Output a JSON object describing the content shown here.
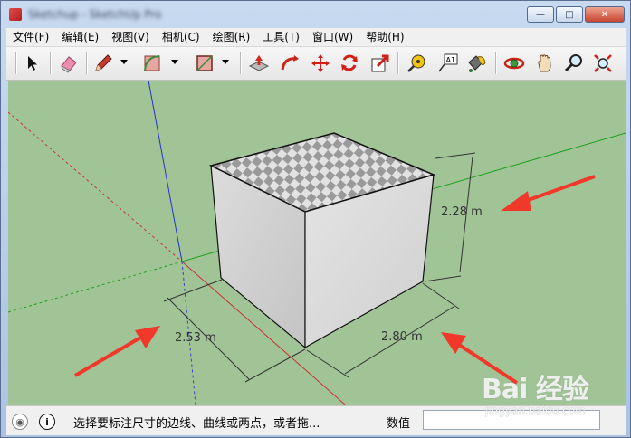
{
  "window": {
    "title": "Sketchup - SketchUp Pro",
    "btn_minimize": "—",
    "btn_maximize": "□",
    "btn_close": "✕"
  },
  "menu": {
    "items": [
      {
        "label": "文件(F)"
      },
      {
        "label": "编辑(E)"
      },
      {
        "label": "视图(V)"
      },
      {
        "label": "相机(C)"
      },
      {
        "label": "绘图(R)"
      },
      {
        "label": "工具(T)"
      },
      {
        "label": "窗口(W)"
      },
      {
        "label": "帮助(H)"
      }
    ]
  },
  "toolbar": {
    "icons": [
      "select-arrow-icon",
      "eraser-icon",
      "pencil-icon",
      "arc-icon",
      "rectangle-icon",
      "push-pull-icon",
      "follow-me-icon",
      "move-icon",
      "rotate-icon",
      "scale-icon",
      "tape-measure-icon",
      "text-label-icon",
      "paint-bucket-icon",
      "orbit-icon",
      "pan-icon",
      "zoom-icon",
      "zoom-extents-icon"
    ],
    "text_tool_glyph": "A1"
  },
  "viewport": {
    "dimensions": [
      {
        "label": "2.28 m"
      },
      {
        "label": "2.53 m"
      },
      {
        "label": "2.80 m"
      }
    ],
    "colors": {
      "ground": "#a1c497",
      "arrow": "#f0392b",
      "axis_red": "#c83232",
      "axis_green": "#1aa01a",
      "axis_blue": "#2233cc"
    }
  },
  "status": {
    "message": "选择要标注尺寸的边线、曲线或两点，或者拖...",
    "vcb_label": "数值",
    "vcb_value": ""
  },
  "watermark": {
    "logo": "Bai 经验",
    "url": "jingyan.baidu.com"
  }
}
